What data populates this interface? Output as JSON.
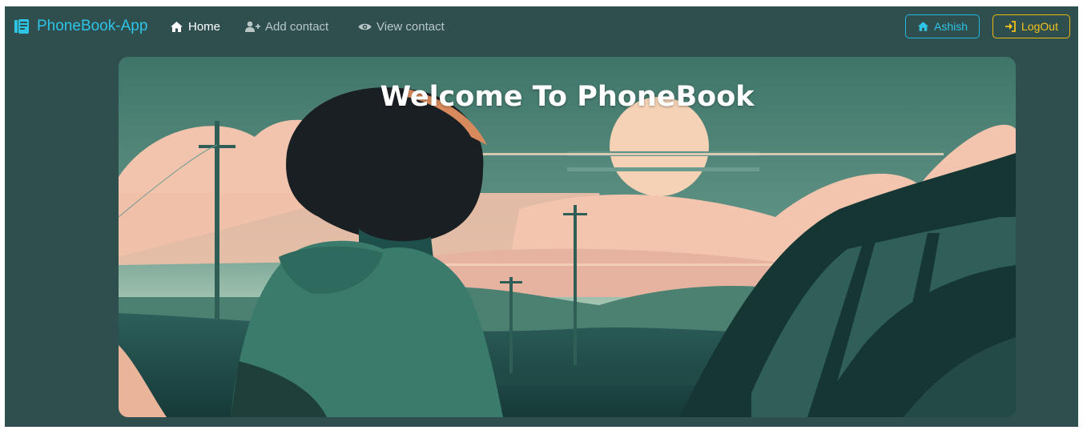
{
  "navbar": {
    "brand": "PhoneBook-App",
    "links": [
      {
        "label": "Home",
        "icon": "home-icon",
        "active": true
      },
      {
        "label": "Add contact",
        "icon": "user-plus-icon",
        "active": false
      },
      {
        "label": "View contact",
        "icon": "eye-icon",
        "active": false
      }
    ],
    "user_button": "Ashish",
    "logout_button": "LogOut"
  },
  "hero": {
    "title": "Welcome To PhoneBook",
    "image": "anime-boy-sunset-illustration"
  },
  "colors": {
    "page_bg": "#2f4f4f",
    "brand": "#2ec4e6",
    "user_button": "#1fb8e0",
    "logout_button": "#e8b90f"
  }
}
